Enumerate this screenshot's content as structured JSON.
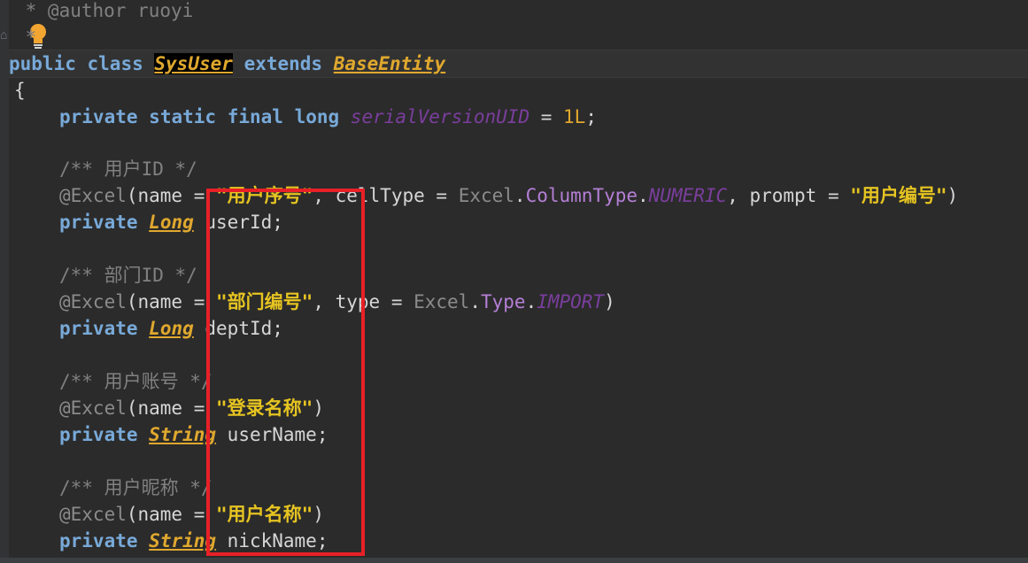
{
  "editor": {
    "comment_author": " * @author ruoyi",
    "comment_end_partial": " *",
    "class_decl": {
      "kw_public": "public",
      "kw_class": "class",
      "class_name": "SysUser",
      "kw_extends": "extends",
      "parent_class": "BaseEntity"
    },
    "open_brace": "{",
    "serial_line": {
      "kw_private": "private",
      "kw_static": "static",
      "kw_final": "final",
      "kw_long": "long",
      "field_name": "serialVersionUID",
      "eq": " = ",
      "value": "1L",
      "semi": ";"
    },
    "fields": [
      {
        "comment": "/** 用户ID */",
        "ann_prefix": "@Excel",
        "ann_open": "(name = ",
        "name_value": "\"用户序号\"",
        "ann_mid1": ", cellType = ",
        "excel_ref": "Excel",
        "dot1": ".",
        "type_ref": "ColumnType",
        "dot2": ".",
        "enum_value": "NUMERIC",
        "ann_mid2": ", prompt = ",
        "prompt_value": "\"用户编号\"",
        "ann_close": ")",
        "kw_private": "private",
        "type": "Long",
        "var": " userId;"
      },
      {
        "comment": "/** 部门ID */",
        "ann_prefix": "@Excel",
        "ann_open": "(name = ",
        "name_value": "\"部门编号\"",
        "ann_mid1": ", type = ",
        "excel_ref": "Excel",
        "dot1": ".",
        "type_ref": "Type",
        "dot2": ".",
        "enum_value": "IMPORT",
        "ann_close": ")",
        "kw_private": "private",
        "type": "Long",
        "var": " deptId;"
      },
      {
        "comment": "/** 用户账号 */",
        "ann_prefix": "@Excel",
        "ann_open": "(name = ",
        "name_value": "\"登录名称\"",
        "ann_close": ")",
        "kw_private": "private",
        "type": "String",
        "var": " userName;"
      },
      {
        "comment": "/** 用户昵称 */",
        "ann_prefix": "@Excel",
        "ann_open": "(name = ",
        "name_value": "\"用户名称\"",
        "ann_close": ")",
        "kw_private": "private",
        "type": "String",
        "var": " nickName;"
      }
    ]
  },
  "colors": {
    "background": "#2b2b2b",
    "keyword": "#78a9d8",
    "class_ref": "#e0a82e",
    "string": "#e6c421",
    "comment": "#808080",
    "static_field": "#7a3e9d",
    "highlight_box": "#e82027"
  },
  "icons": {
    "intention": "lightbulb-icon",
    "fold": "fold-marker-icon"
  }
}
